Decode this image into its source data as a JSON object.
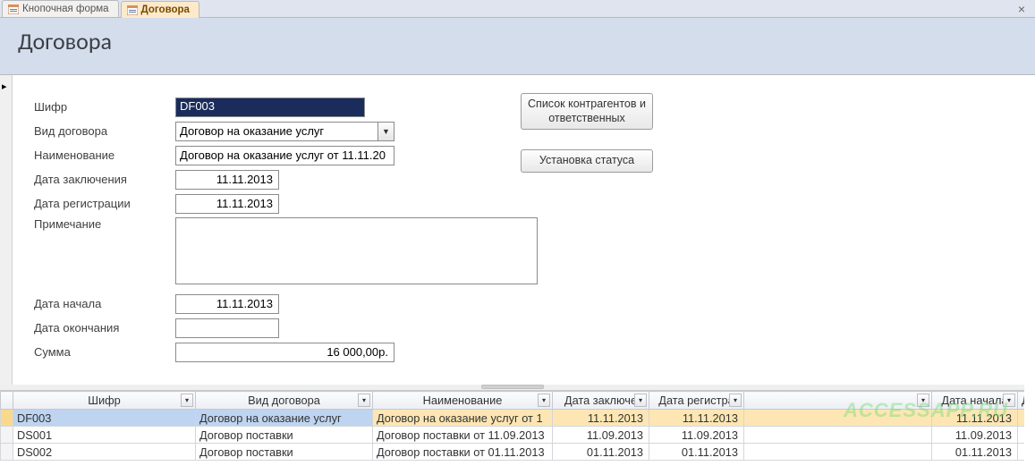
{
  "tabs": {
    "tab1": "Кнопочная форма",
    "tab2": "Договора"
  },
  "header": {
    "title": "Договора"
  },
  "labels": {
    "cipher": "Шифр",
    "kind": "Вид договора",
    "name": "Наименование",
    "date_concl": "Дата заключения",
    "date_reg": "Дата регистрации",
    "note": "Примечание",
    "date_start": "Дата начала",
    "date_end": "Дата окончания",
    "sum": "Сумма"
  },
  "form": {
    "cipher": "DF003",
    "kind": "Договор на оказание услуг",
    "name": "Договор на оказание услуг от 11.11.20",
    "date_concl": "11.11.2013",
    "date_reg": "11.11.2013",
    "note": "",
    "date_start": "11.11.2013",
    "date_end": "",
    "sum": "16 000,00р."
  },
  "buttons": {
    "contractors": "Список контрагентов и ответственных",
    "status": "Установка статуса"
  },
  "grid": {
    "headers": {
      "cipher": "Шифр",
      "kind": "Вид договора",
      "name": "Наименование",
      "date_concl": "Дата заключе",
      "date_reg": "Дата регистра",
      "blank": "",
      "date_start": "Дата начала",
      "last": "Д"
    },
    "rows": [
      {
        "cipher": "DF003",
        "kind": "Договор на оказание услуг",
        "name": "Договор на оказание услуг от 1",
        "date_concl": "11.11.2013",
        "date_reg": "11.11.2013",
        "blank": "",
        "date_start": "11.11.2013"
      },
      {
        "cipher": "DS001",
        "kind": "Договор поставки",
        "name": "Договор поставки от 11.09.2013",
        "date_concl": "11.09.2013",
        "date_reg": "11.09.2013",
        "blank": "",
        "date_start": "11.09.2013"
      },
      {
        "cipher": "DS002",
        "kind": "Договор поставки",
        "name": "Договор поставки от 01.11.2013",
        "date_concl": "01.11.2013",
        "date_reg": "01.11.2013",
        "blank": "",
        "date_start": "01.11.2013"
      }
    ]
  },
  "watermark": "ACCESSAPP.RU"
}
